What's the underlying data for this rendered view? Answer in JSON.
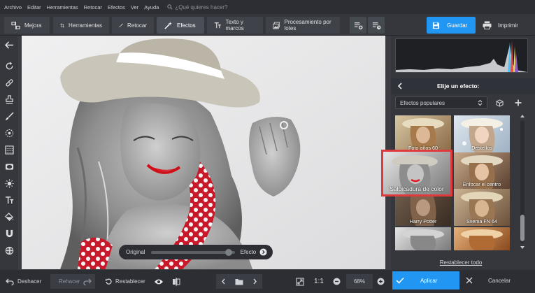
{
  "menu": {
    "items": [
      "Archivo",
      "Editar",
      "Herramientas",
      "Retocar",
      "Efectos",
      "Ver",
      "Ayuda"
    ],
    "search_placeholder": "¿Qué quieres hacer?"
  },
  "toolbar": {
    "tabs": [
      {
        "label": "Mejora",
        "icon": "enhance-icon"
      },
      {
        "label": "Herramientas",
        "icon": "crop-icon"
      },
      {
        "label": "Retocar",
        "icon": "brush-icon"
      },
      {
        "label": "Efectos",
        "icon": "magic-wand-icon"
      },
      {
        "label": "Texto y marcos",
        "icon": "text-icon"
      },
      {
        "label": "Procesamiento por lotes",
        "icon": "batch-icon"
      }
    ],
    "active_tab": "Efectos",
    "save_label": "Guardar",
    "print_label": "Imprimir"
  },
  "compare": {
    "original_label": "Original",
    "effect_label": "Efecto",
    "position": 0.93
  },
  "panel": {
    "title": "Elije un efecto:",
    "preset_select_value": "Efectos populares",
    "effects": [
      {
        "label": "Foto años 60"
      },
      {
        "label": "Destellos"
      },
      {
        "label": "Salpicadura de color",
        "selected": true
      },
      {
        "label": "Enfocar el centro"
      },
      {
        "label": "Harry Potter"
      },
      {
        "label": "Svema FN 64"
      },
      {
        "label": ""
      },
      {
        "label": ""
      }
    ],
    "reset_all_label": "Restablecer todo"
  },
  "bottom": {
    "undo_label": "Deshacer",
    "redo_label": "Rehacer",
    "reset_label": "Restablecer",
    "zoom_1to1": "1:1",
    "zoom_value": "68%",
    "apply_label": "Aplicar",
    "cancel_label": "Cancelar"
  },
  "colors": {
    "accent": "#2196f3",
    "selection": "#e03a3e"
  }
}
